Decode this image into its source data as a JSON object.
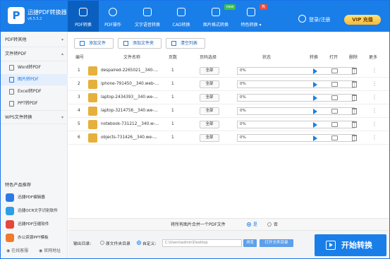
{
  "app": {
    "name": "迅捷PDF转换器",
    "version": "v6.5.5.2",
    "logo_letter": "P"
  },
  "nav": [
    {
      "label": "PDF转换",
      "icon": "convert-icon",
      "active": true
    },
    {
      "label": "PDF操作",
      "icon": "gear-icon"
    },
    {
      "label": "文字语音转换",
      "icon": "audio-icon"
    },
    {
      "label": "CAD转换",
      "icon": "cad-icon"
    },
    {
      "label": "图片格式转换",
      "icon": "image-icon",
      "badge": "new"
    },
    {
      "label": "特色转换 ▾",
      "icon": "feature-icon",
      "badge": "热"
    }
  ],
  "user": {
    "login_label": "登录/注册"
  },
  "vip": {
    "label": "VIP 充值"
  },
  "sidebar": {
    "sections": [
      {
        "label": "PDF转其他",
        "chev": "▾"
      },
      {
        "label": "文件转PDF",
        "chev": "▴"
      },
      {
        "label": "WPS文件转换",
        "chev": "▾"
      }
    ],
    "items": [
      {
        "label": "Word转PDF"
      },
      {
        "label": "图片转PDF"
      },
      {
        "label": "Excel转PDF"
      },
      {
        "label": "PPT转PDF"
      }
    ],
    "promo_title": "特色产品推荐",
    "promos": [
      {
        "label": "迅捷PDF编辑器",
        "color": "#2c7be5"
      },
      {
        "label": "迅捷OCR文字识别软件",
        "color": "#2c9fe8"
      },
      {
        "label": "迅捷PDF压缩软件",
        "color": "#e8453c"
      },
      {
        "label": "办公资源PPT模板",
        "color": "#f07b2c"
      }
    ],
    "online_service": "◉ 在线客服",
    "website": "◉ 官网地址"
  },
  "toolbar": {
    "add_file": "添加文件",
    "add_folder": "添加文件夹",
    "clear_list": "清空列表"
  },
  "table": {
    "headers": [
      "编号",
      "文件名称",
      "页数",
      "页码选择",
      "状态",
      "转换",
      "打开",
      "删除",
      "更多"
    ],
    "rows": [
      {
        "num": "1",
        "name": "despaired-2265021__340-...",
        "pages": "1",
        "range": "全部",
        "status": "0%"
      },
      {
        "num": "2",
        "name": "iphone-791450__340.web-...",
        "pages": "1",
        "range": "全部",
        "status": "0%"
      },
      {
        "num": "3",
        "name": "laptop-2434393__340.we-...",
        "pages": "1",
        "range": "全部",
        "status": "0%"
      },
      {
        "num": "4",
        "name": "laptop-3214756__340.we-...",
        "pages": "1",
        "range": "全部",
        "status": "0%"
      },
      {
        "num": "5",
        "name": "notebook-731212__340.w-...",
        "pages": "1",
        "range": "全部",
        "status": "0%"
      },
      {
        "num": "6",
        "name": "objects-731426__340.we-...",
        "pages": "1",
        "range": "全部",
        "status": "0%"
      }
    ],
    "more_glyph": "⋮"
  },
  "merge": {
    "label": "将所有图片合并一个PDF文件",
    "yes": "是",
    "no": "否",
    "selected": "yes"
  },
  "output": {
    "label": "输出目录:",
    "option_source": "原文件夹目录",
    "option_custom": "自定义:",
    "selected": "custom",
    "path": "C:\\Users\\admin\\Desktop",
    "browse": "浏览",
    "open_folder": "打开文件目录"
  },
  "start_button": "开始转换",
  "colors": {
    "brand": "#1a7ee8",
    "vip": "#f8b936"
  }
}
